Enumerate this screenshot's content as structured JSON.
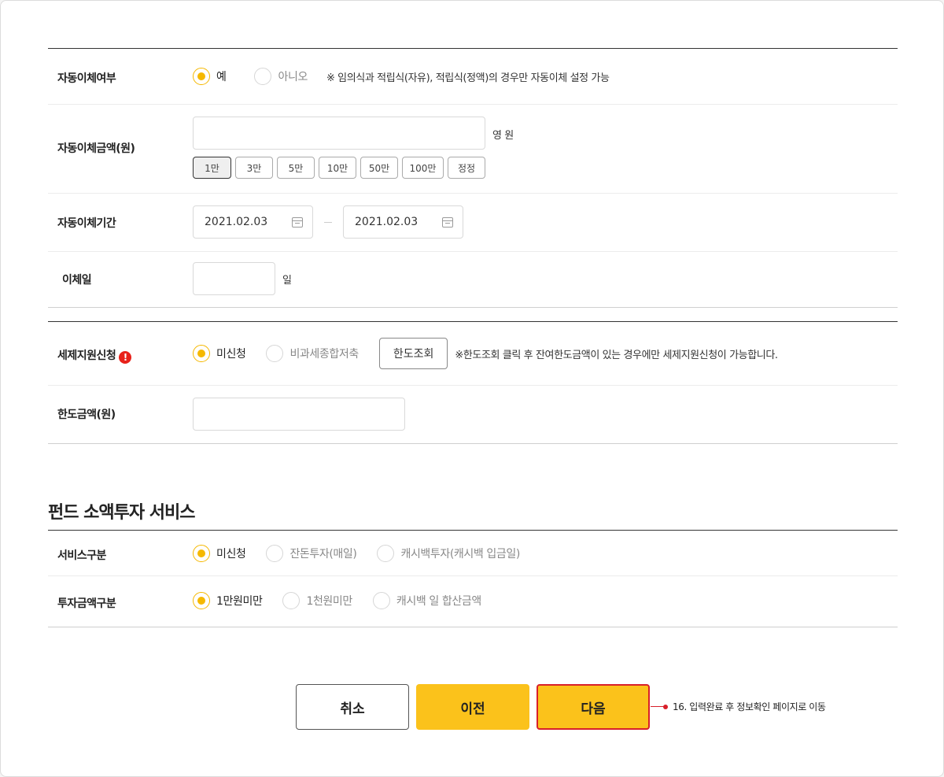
{
  "auto_transfer": {
    "enabled_label": "자동이체여부",
    "options": [
      "예",
      "아니오"
    ],
    "note": "※ 임의식과 적립식(자유), 적립식(정액)의 경우만 자동이체 설정 가능",
    "amount_label": "자동이체금액(원)",
    "amount_value": "",
    "amount_unit": "영 원",
    "chips": [
      "1만",
      "3만",
      "5만",
      "10만",
      "50만",
      "100만",
      "정정"
    ],
    "period_label": "자동이체기간",
    "start_date": "2021.02.03",
    "end_date": "2021.02.03",
    "day_label": "이체일",
    "day_value": "",
    "day_unit": "일"
  },
  "tax": {
    "label": "세제지원신청",
    "warn_icon": "!",
    "options": [
      "미신청",
      "비과세종합저축"
    ],
    "limit_button": "한도조회",
    "note": "※한도조회 클릭 후 잔여한도금액이 있는 경우에만 세제지원신청이 가능합니다.",
    "limit_label": "한도금액(원)",
    "limit_value": ""
  },
  "small_invest": {
    "title": "펀드 소액투자 서비스",
    "service_label": "서비스구분",
    "service_options": [
      "미신청",
      "잔돈투자(매일)",
      "캐시백투자(캐시백 입금일)"
    ],
    "amount_label": "투자금액구분",
    "amount_options": [
      "1만원미만",
      "1천원미만",
      "캐시백 일 합산금액"
    ]
  },
  "buttons": {
    "cancel": "취소",
    "prev": "이전",
    "next": "다음"
  },
  "annotation": "16. 입력완료 후 정보확인 페이지로 이동",
  "colors": {
    "accent": "#fbc21b",
    "radio": "#f5b800",
    "highlight": "#d8202a",
    "warn": "#e8211a"
  },
  "icons": [
    "calendar-icon",
    "warning-icon"
  ]
}
